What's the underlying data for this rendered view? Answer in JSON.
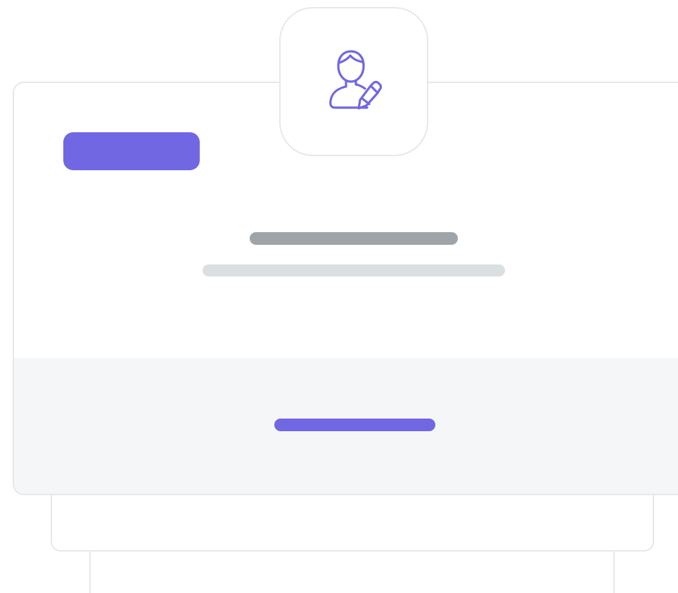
{
  "icon": {
    "name": "user-edit-icon"
  },
  "colors": {
    "accent": "#7167e3",
    "title_placeholder": "#9ea4a8",
    "subtitle_placeholder": "#dadfe2",
    "footer_background": "#f5f6f8",
    "border": "#e7e8ea"
  }
}
